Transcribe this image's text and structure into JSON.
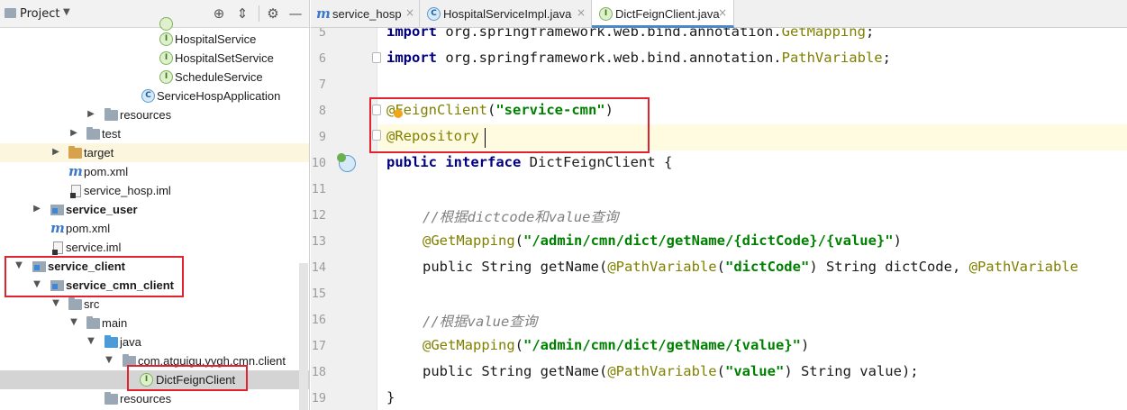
{
  "panel": {
    "title": "Project",
    "icons": [
      "crosshair-icon",
      "collapse-icon",
      "settings-icon",
      "minimize-icon"
    ]
  },
  "tree": [
    {
      "label": "HospitalService",
      "icon": "interface-icon",
      "glyph": "I"
    },
    {
      "label": "HospitalSetService",
      "icon": "interface-icon",
      "glyph": "I"
    },
    {
      "label": "ScheduleService",
      "icon": "interface-icon",
      "glyph": "I"
    },
    {
      "label": "ServiceHospApplication",
      "icon": "class-icon",
      "glyph": "C"
    },
    {
      "label": "resources",
      "icon": "folder-icon"
    },
    {
      "label": "test",
      "icon": "folder-icon"
    },
    {
      "label": "target",
      "icon": "folder-icon"
    },
    {
      "label": "pom.xml",
      "icon": "maven-icon",
      "glyph": "m"
    },
    {
      "label": "service_hosp.iml",
      "icon": "iml-file-icon"
    },
    {
      "label": "service_user",
      "icon": "module-icon"
    },
    {
      "label": "pom.xml",
      "icon": "maven-icon",
      "glyph": "m"
    },
    {
      "label": "service.iml",
      "icon": "iml-file-icon"
    },
    {
      "label": "service_client",
      "icon": "module-icon"
    },
    {
      "label": "service_cmn_client",
      "icon": "module-icon"
    },
    {
      "label": "src",
      "icon": "folder-icon"
    },
    {
      "label": "main",
      "icon": "folder-icon"
    },
    {
      "label": "java",
      "icon": "source-folder-icon"
    },
    {
      "label": "com.atguigu.yygh.cmn.client",
      "icon": "package-icon"
    },
    {
      "label": "DictFeignClient",
      "icon": "interface-icon",
      "glyph": "I"
    },
    {
      "label": "resources",
      "icon": "folder-icon"
    }
  ],
  "tabs": [
    {
      "label": "service_hosp",
      "icon": "maven-icon",
      "glyph": "m",
      "active": false
    },
    {
      "label": "HospitalServiceImpl.java",
      "icon": "class-icon",
      "glyph": "C",
      "active": false
    },
    {
      "label": "DictFeignClient.java",
      "icon": "interface-icon",
      "glyph": "I",
      "active": true
    }
  ],
  "close_glyph": "×",
  "editor": {
    "line_numbers": [
      "5",
      "6",
      "7",
      "8",
      "9",
      "10",
      "11",
      "12",
      "13",
      "14",
      "15",
      "16",
      "17",
      "18",
      "19"
    ],
    "lines": {
      "l5": {
        "kw": "import",
        "text": " org.springframework.web.bind.annotation.",
        "ann": "GetMapping",
        "end": ";"
      },
      "l6": {
        "kw": "import",
        "text": " org.springframework.web.bind.annotation.",
        "ann": "PathVariable",
        "end": ";"
      },
      "l8": {
        "ann": "@FeignClient",
        "open": "(",
        "str": "\"service-cmn\"",
        "close": ")"
      },
      "l9": {
        "ann": "@Repository"
      },
      "l10": {
        "kw1": "public",
        "kw2": "interface",
        "text": " DictFeignClient {"
      },
      "l12": {
        "comment": "//根据dictcode和value查询"
      },
      "l13": {
        "ann": "@GetMapping",
        "open": "(",
        "str": "\"/admin/cmn/dict/getName/{dictCode}/{value}\"",
        "close": ")"
      },
      "l14": {
        "text1": "public String getName(",
        "ann1": "@PathVariable",
        "open": "(",
        "str": "\"dictCode\"",
        "text2": ") String dictCode, ",
        "ann2": "@PathVariable"
      },
      "l16": {
        "comment": "//根据value查询"
      },
      "l17": {
        "ann": "@GetMapping",
        "open": "(",
        "str": "\"/admin/cmn/dict/getName/{value}\"",
        "close": ")"
      },
      "l18": {
        "text1": "public String getName(",
        "ann1": "@PathVariable",
        "open": "(",
        "str": "\"value\"",
        "text2": ") String value);"
      },
      "l19": {
        "text": "}"
      }
    }
  },
  "colors": {
    "keyword": "#000080",
    "annotation": "#808000",
    "string": "#008000",
    "comment": "#808080",
    "highlight_box": "#e0232f",
    "current_line": "#fffbe0"
  }
}
